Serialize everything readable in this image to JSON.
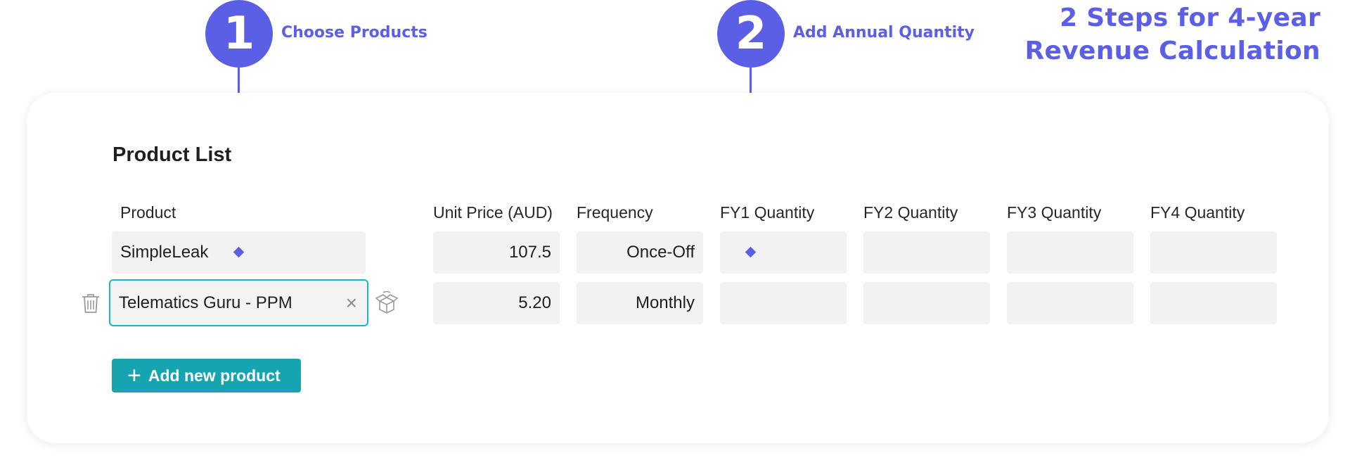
{
  "headline": {
    "line1": "2 Steps for 4-year",
    "line2": "Revenue Calculation"
  },
  "steps": [
    {
      "number": "1",
      "label": "Choose Products"
    },
    {
      "number": "2",
      "label": "Add Annual Quantity"
    }
  ],
  "product_list": {
    "title": "Product List",
    "columns": [
      "Product",
      "Unit Price (AUD)",
      "Frequency",
      "FY1 Quantity",
      "FY2 Quantity",
      "FY3 Quantity",
      "FY4 Quantity"
    ],
    "rows": [
      {
        "product": "SimpleLeak",
        "unit_price": "107.5",
        "frequency": "Once-Off",
        "fy1": "",
        "fy2": "",
        "fy3": "",
        "fy4": ""
      },
      {
        "product": "Telematics Guru - PPM",
        "unit_price": "5.20",
        "frequency": "Monthly",
        "fy1": "",
        "fy2": "",
        "fy3": "",
        "fy4": ""
      }
    ],
    "add_button_label": "Add new product"
  },
  "icons": [
    "trash-icon",
    "clear-icon",
    "product-box-icon",
    "plus-icon"
  ],
  "colors": {
    "accent": "#5b5fe6",
    "teal": "#16a4b0",
    "focus_border": "#1ab8c6",
    "field_bg": "#f2f2f2"
  }
}
